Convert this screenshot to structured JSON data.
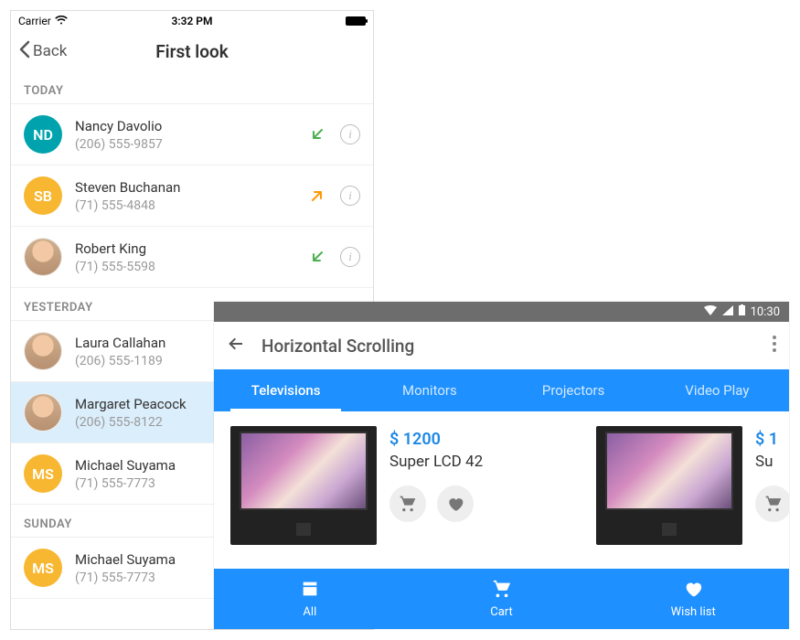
{
  "ios": {
    "status": {
      "carrier": "Carrier",
      "time": "3:32 PM"
    },
    "nav": {
      "back": "Back",
      "title": "First look"
    },
    "sections": [
      {
        "header": "TODAY",
        "rows": [
          {
            "initials": "ND",
            "avatar_color": "#00a3ad",
            "name": "Nancy Davolio",
            "phone": "(206) 555-9857",
            "dir": "in",
            "selected": false
          },
          {
            "initials": "SB",
            "avatar_color": "#f7b731",
            "name": "Steven Buchanan",
            "phone": "(71) 555-4848",
            "dir": "out",
            "selected": false
          },
          {
            "initials": "",
            "avatar_color": "photo",
            "name": "Robert King",
            "phone": "(71) 555-5598",
            "dir": "in",
            "selected": false
          }
        ]
      },
      {
        "header": "YESTERDAY",
        "rows": [
          {
            "initials": "",
            "avatar_color": "photo",
            "name": "Laura Callahan",
            "phone": "(206) 555-1189",
            "dir": "",
            "selected": false
          },
          {
            "initials": "",
            "avatar_color": "photo",
            "name": "Margaret Peacock",
            "phone": "(206) 555-8122",
            "dir": "",
            "selected": true
          },
          {
            "initials": "MS",
            "avatar_color": "#f7b731",
            "name": "Michael Suyama",
            "phone": "(71) 555-7773",
            "dir": "",
            "selected": false
          }
        ]
      },
      {
        "header": "SUNDAY",
        "rows": [
          {
            "initials": "MS",
            "avatar_color": "#f7b731",
            "name": "Michael Suyama",
            "phone": "(71) 555-7773",
            "dir": "",
            "selected": false
          }
        ]
      }
    ]
  },
  "android": {
    "status_time": "10:30",
    "appbar": {
      "title": "Horizontal Scrolling"
    },
    "tabs": [
      "Televisions",
      "Monitors",
      "Projectors",
      "Video Play"
    ],
    "active_tab": 0,
    "products": [
      {
        "price": "$ 1200",
        "name": "Super LCD 42"
      },
      {
        "price": "$ 1",
        "name": "Su"
      }
    ],
    "bottom": [
      {
        "icon": "store",
        "label": "All"
      },
      {
        "icon": "cart",
        "label": "Cart"
      },
      {
        "icon": "heart",
        "label": "Wish list"
      }
    ]
  }
}
